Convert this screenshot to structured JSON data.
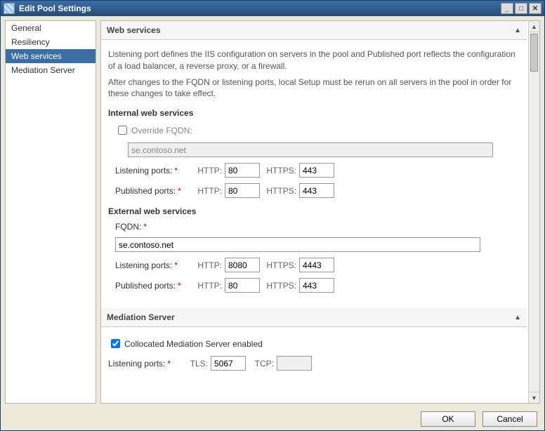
{
  "window": {
    "title": "Edit Pool Settings"
  },
  "sidebar": {
    "items": [
      {
        "label": "General"
      },
      {
        "label": "Resiliency"
      },
      {
        "label": "Web services"
      },
      {
        "label": "Mediation Server"
      }
    ],
    "selected_index": 2
  },
  "sections": {
    "web": {
      "title": "Web services",
      "para1": "Listening port defines the IIS configuration on servers in the pool and Published port reflects the configuration of a load balancer, a reverse proxy, or a firewall.",
      "para2": "After changes to the FQDN or listening ports, local Setup must be rerun on all servers in the pool in order for these changes to take effect.",
      "internal_head": "Internal web services",
      "override_label": "Override FQDN:",
      "override_checked": false,
      "internal_fqdn": "se.contoso.net",
      "listening_label": "Listening ports:",
      "published_label": "Published ports:",
      "http_lbl": "HTTP:",
      "https_lbl": "HTTPS:",
      "internal_listen_http": "80",
      "internal_listen_https": "443",
      "internal_pub_http": "80",
      "internal_pub_https": "443",
      "external_head": "External web services",
      "fqdn_lbl": "FQDN:",
      "external_fqdn": "se.contoso.net",
      "external_listen_http": "8080",
      "external_listen_https": "4443",
      "external_pub_http": "80",
      "external_pub_https": "443"
    },
    "mediation": {
      "title": "Mediation Server",
      "collocated_label": "Collocated Mediation Server enabled",
      "collocated_checked": true,
      "listening_label": "Listening ports:",
      "tls_lbl": "TLS:",
      "tcp_lbl": "TCP:",
      "tls_port": "5067",
      "tcp_port": ""
    }
  },
  "footer": {
    "ok": "OK",
    "cancel": "Cancel"
  }
}
